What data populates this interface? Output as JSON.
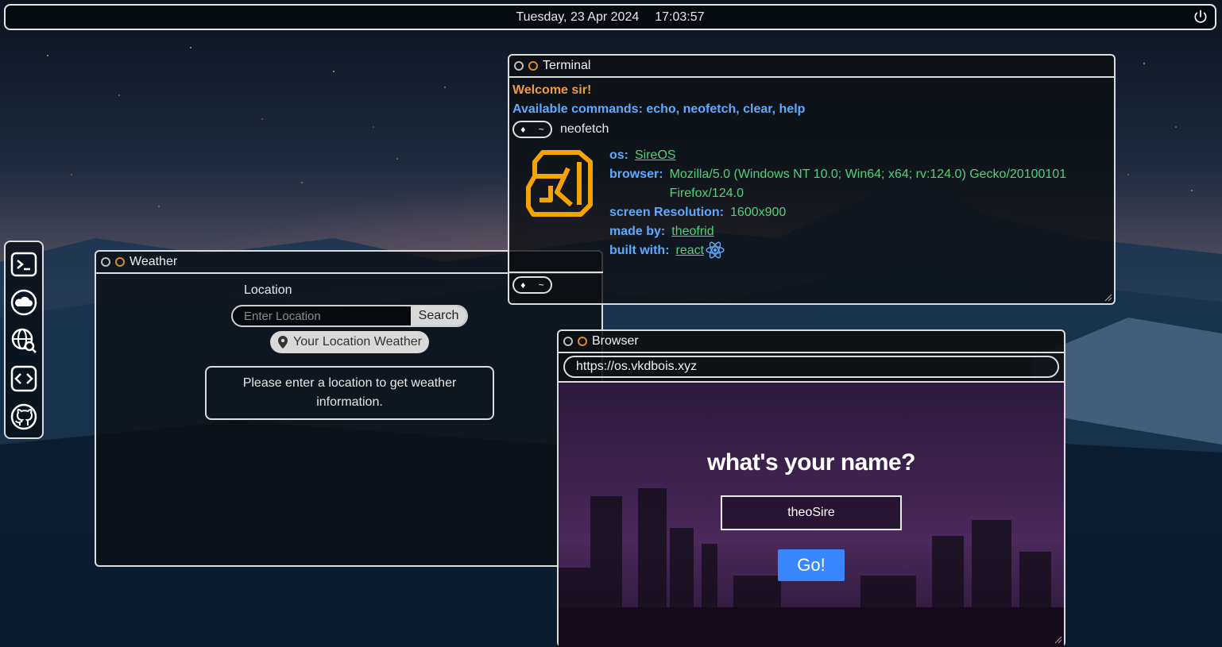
{
  "topbar": {
    "date": "Tuesday, 23 Apr 2024",
    "time": "17:03:57",
    "power_icon": "power-icon"
  },
  "dock": {
    "items": [
      {
        "name": "terminal",
        "icon": "terminal-icon"
      },
      {
        "name": "weather",
        "icon": "cloud-icon"
      },
      {
        "name": "browser",
        "icon": "globe-search-icon"
      },
      {
        "name": "code",
        "icon": "code-icon"
      },
      {
        "name": "github",
        "icon": "github-icon"
      }
    ]
  },
  "weather": {
    "title": "Weather",
    "location_label": "Location",
    "input_placeholder": "Enter Location",
    "search_label": "Search",
    "your_location_label": "Your Location Weather",
    "message": "Please enter a location to get weather information."
  },
  "terminal": {
    "title": "Terminal",
    "welcome": "Welcome sir!",
    "available": "Available commands: echo, neofetch, clear, help",
    "prompt_symbol": "♦",
    "prompt_dir": "~",
    "command": "neofetch",
    "neofetch": {
      "os_label": "os:",
      "os_value": "SireOS",
      "browser_label": "browser:",
      "browser_value": "Mozilla/5.0 (Windows NT 10.0; Win64; x64; rv:124.0) Gecko/20100101 Firefox/124.0",
      "res_label": "screen Resolution:",
      "res_value": "1600x900",
      "made_label": "made by:",
      "made_value": "theofrid",
      "built_label": "built with:",
      "built_value": "react"
    }
  },
  "browser": {
    "title": "Browser",
    "url": "https://os.vkdbois.xyz",
    "heading": "what's your name?",
    "name_value": "theoSire",
    "go_label": "Go!"
  },
  "colors": {
    "accent_orange": "#f39a3b",
    "accent_blue": "#5eaaff",
    "accent_green": "#4fd27a",
    "button_blue": "#3a86ff"
  }
}
